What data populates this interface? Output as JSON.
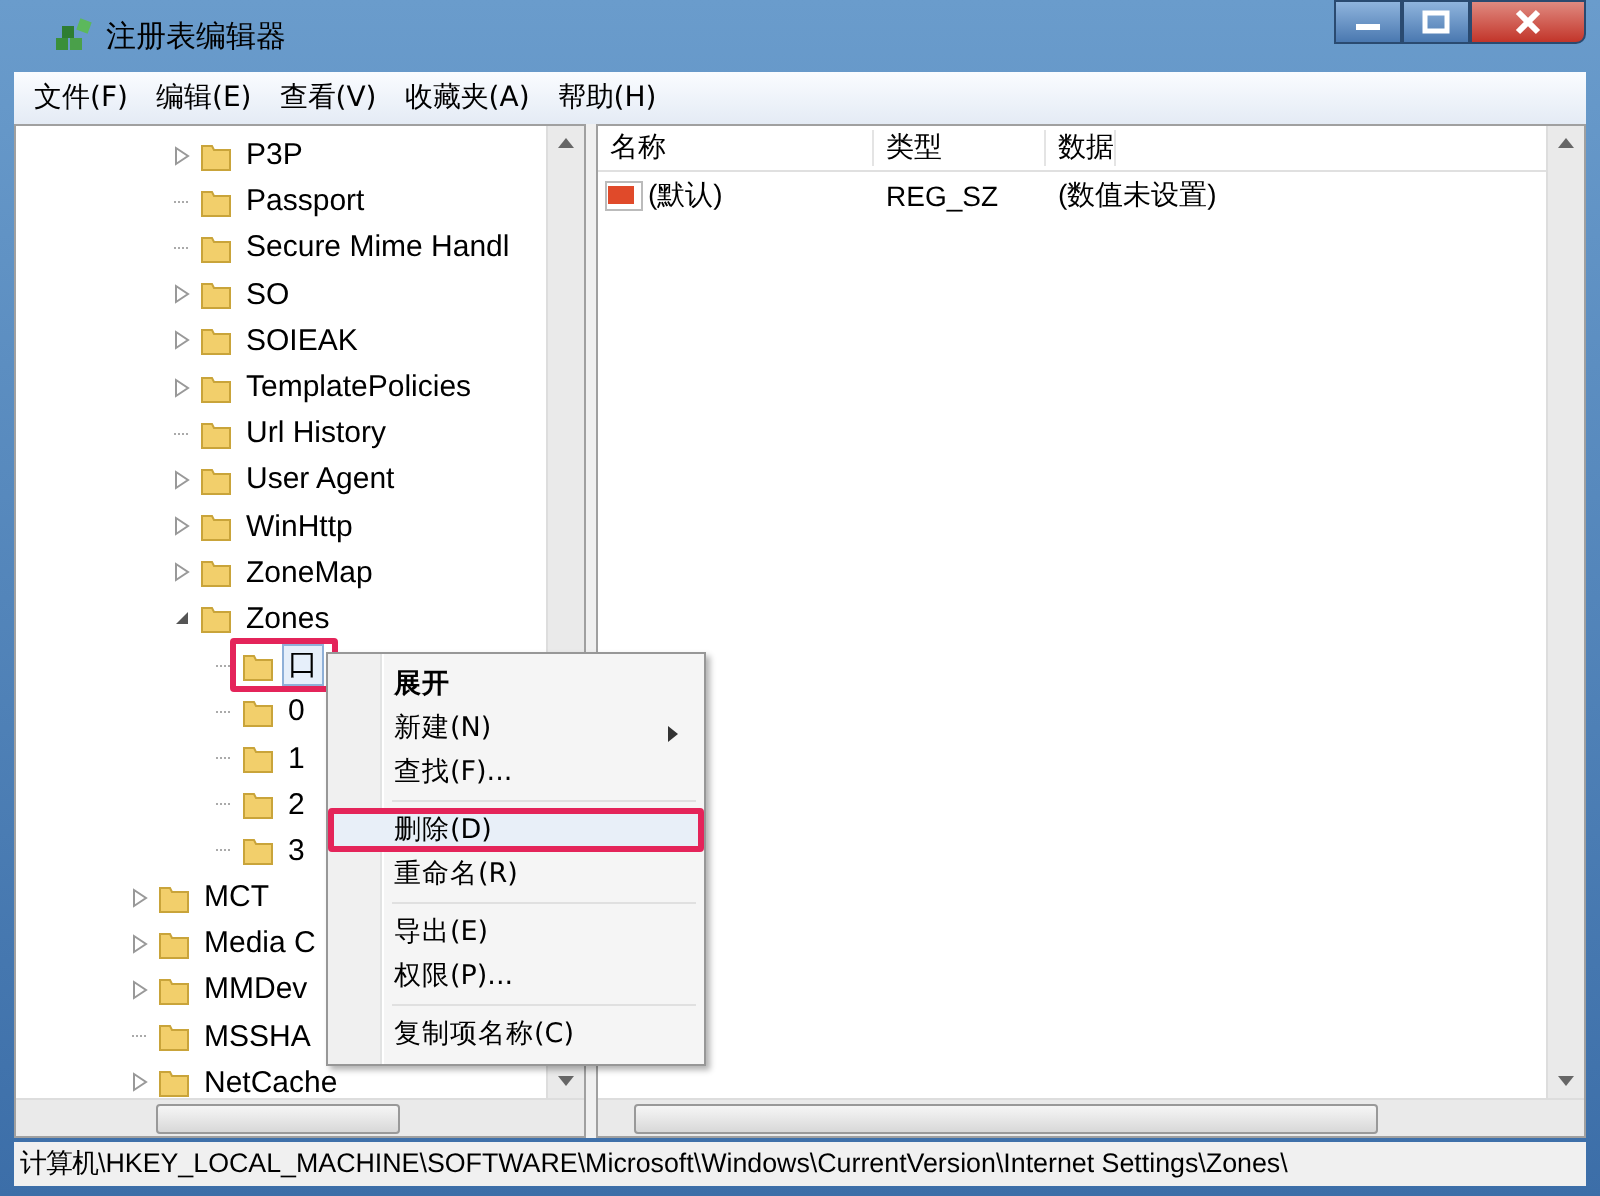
{
  "window": {
    "title": "注册表编辑器"
  },
  "menu_bar": [
    "文件(F)",
    "编辑(E)",
    "查看(V)",
    "收藏夹(A)",
    "帮助(H)"
  ],
  "tree": {
    "items": [
      {
        "kind": "hidden",
        "children": [
          {
            "label": "P3P",
            "kind": "collapsed",
            "selected": false,
            "marked": false
          },
          {
            "label": "Passport",
            "kind": "leaf",
            "selected": false,
            "marked": false
          },
          {
            "label": "Secure Mime Handl",
            "kind": "leaf",
            "selected": false,
            "marked": false
          },
          {
            "label": "SO",
            "kind": "collapsed",
            "selected": false,
            "marked": false
          },
          {
            "label": "SOIEAK",
            "kind": "collapsed",
            "selected": false,
            "marked": false
          },
          {
            "label": "TemplatePolicies",
            "kind": "collapsed",
            "selected": false,
            "marked": false
          },
          {
            "label": "Url History",
            "kind": "leaf",
            "selected": false,
            "marked": false
          },
          {
            "label": "User Agent",
            "kind": "collapsed",
            "selected": false,
            "marked": false
          },
          {
            "label": "WinHttp",
            "kind": "collapsed",
            "selected": false,
            "marked": false
          },
          {
            "label": "ZoneMap",
            "kind": "collapsed",
            "selected": false,
            "marked": false
          },
          {
            "label": "Zones",
            "kind": "expanded",
            "selected": false,
            "marked": false,
            "children": [
              {
                "label": "口",
                "kind": "leaf",
                "selected": true,
                "marked": true
              },
              {
                "label": "0",
                "kind": "leaf",
                "selected": false,
                "marked": false
              },
              {
                "label": "1",
                "kind": "leaf",
                "selected": false,
                "marked": false
              },
              {
                "label": "2",
                "kind": "leaf",
                "selected": false,
                "marked": false
              },
              {
                "label": "3",
                "kind": "leaf",
                "selected": false,
                "marked": false
              }
            ]
          }
        ]
      },
      {
        "label": "MCT",
        "kind": "collapsed",
        "selected": false,
        "marked": false
      },
      {
        "label": "Media C",
        "kind": "collapsed",
        "selected": false,
        "marked": false
      },
      {
        "label": "MMDev",
        "kind": "collapsed",
        "selected": false,
        "marked": false
      },
      {
        "label": "MSSHA",
        "kind": "leaf",
        "selected": false,
        "marked": false
      },
      {
        "label": "NetCache",
        "kind": "collapsed",
        "selected": false,
        "marked": false
      }
    ]
  },
  "values": {
    "columns": [
      "名称",
      "类型",
      "数据"
    ],
    "rows": [
      {
        "name": "(默认)",
        "type": "REG_SZ",
        "data": "(数值未设置)"
      }
    ]
  },
  "context_menu": {
    "items": [
      {
        "kind": "item",
        "label": "展开",
        "default": true,
        "submenu": false,
        "selected": false,
        "marked": false
      },
      {
        "kind": "item",
        "label": "新建(N)",
        "default": false,
        "submenu": true,
        "selected": false,
        "marked": false
      },
      {
        "kind": "item",
        "label": "查找(F)...",
        "default": false,
        "submenu": false,
        "selected": false,
        "marked": false
      },
      {
        "kind": "separator"
      },
      {
        "kind": "item",
        "label": "删除(D)",
        "default": false,
        "submenu": false,
        "selected": true,
        "marked": true
      },
      {
        "kind": "item",
        "label": "重命名(R)",
        "default": false,
        "submenu": false,
        "selected": false,
        "marked": false
      },
      {
        "kind": "separator"
      },
      {
        "kind": "item",
        "label": "导出(E)",
        "default": false,
        "submenu": false,
        "selected": false,
        "marked": false
      },
      {
        "kind": "item",
        "label": "权限(P)...",
        "default": false,
        "submenu": false,
        "selected": false,
        "marked": false
      },
      {
        "kind": "separator"
      },
      {
        "kind": "item",
        "label": "复制项名称(C)",
        "default": false,
        "submenu": false,
        "selected": false,
        "marked": false
      }
    ]
  },
  "status_bar": "计算机\\HKEY_LOCAL_MACHINE\\SOFTWARE\\Microsoft\\Windows\\CurrentVersion\\Internet Settings\\Zones\\"
}
